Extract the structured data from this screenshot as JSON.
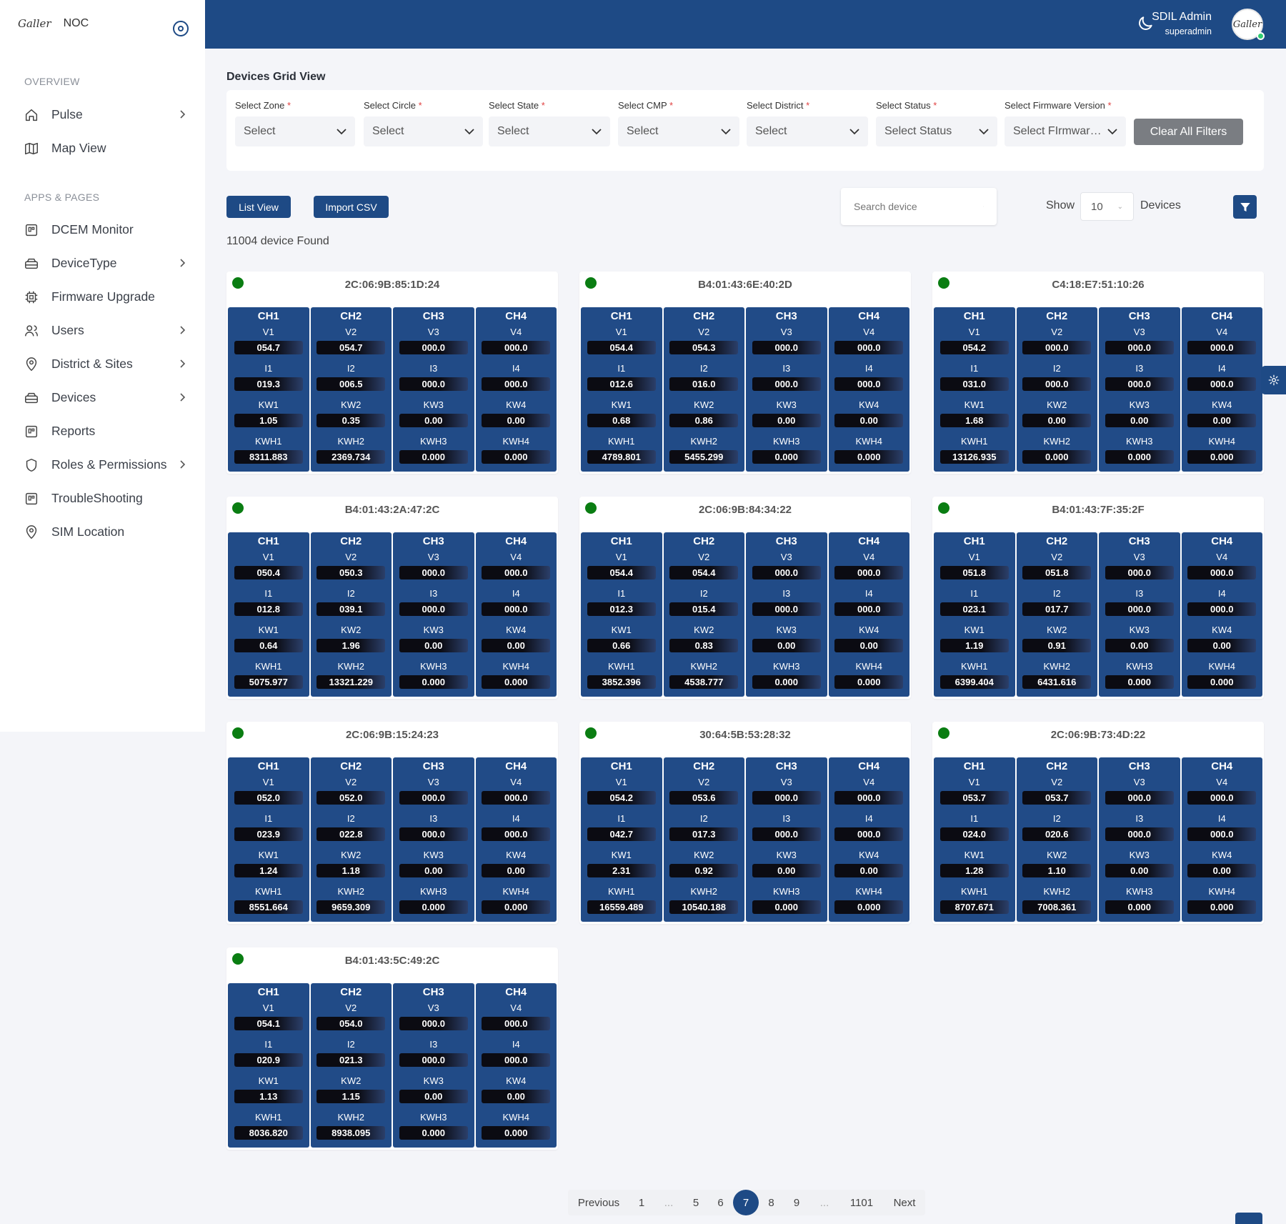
{
  "brand": {
    "logo": "Galler",
    "name": "NOC"
  },
  "sidebar": {
    "overview_title": "OVERVIEW",
    "overview_items": [
      {
        "label": "Pulse",
        "icon": "home-icon",
        "chevron": true
      },
      {
        "label": "Map View",
        "icon": "map-icon",
        "chevron": false
      }
    ],
    "apps_title": "APPS & PAGES",
    "apps_items": [
      {
        "label": "DCEM Monitor",
        "icon": "monitor-icon",
        "chevron": false
      },
      {
        "label": "DeviceType",
        "icon": "device-type-icon",
        "chevron": true
      },
      {
        "label": "Firmware Upgrade",
        "icon": "chip-icon",
        "chevron": false
      },
      {
        "label": "Users",
        "icon": "users-icon",
        "chevron": true
      },
      {
        "label": "District & Sites",
        "icon": "location-icon",
        "chevron": true
      },
      {
        "label": "Devices",
        "icon": "devices-icon",
        "chevron": true
      },
      {
        "label": "Reports",
        "icon": "reports-icon",
        "chevron": false
      },
      {
        "label": "Roles & Permissions",
        "icon": "shield-icon",
        "chevron": true
      },
      {
        "label": "TroubleShooting",
        "icon": "troubleshoot-icon",
        "chevron": false
      },
      {
        "label": "SIM Location",
        "icon": "pin-icon",
        "chevron": false
      }
    ]
  },
  "header": {
    "user_name": "SDIL Admin",
    "user_role": "superadmin",
    "avatar_text": "Galler"
  },
  "main": {
    "title": "Devices Grid View",
    "filters": [
      {
        "label": "Select Zone",
        "value": "Select"
      },
      {
        "label": "Select Circle",
        "value": "Select"
      },
      {
        "label": "Select State",
        "value": "Select"
      },
      {
        "label": "Select CMP",
        "value": "Select"
      },
      {
        "label": "Select District",
        "value": "Select"
      },
      {
        "label": "Select Status",
        "value": "Select Status"
      },
      {
        "label": "Select Firmware Version",
        "value": "Select FIrmware Version"
      }
    ],
    "required_mark": "*",
    "clear_filters": "Clear All Filters",
    "list_view": "List View",
    "import_csv": "Import CSV",
    "search_placeholder": "Search device",
    "show_label": "Show",
    "show_value": "10",
    "devices_label": "Devices",
    "found_text": "11004 device Found"
  },
  "devices": [
    {
      "mac": "2C:06:9B:85:1D:24",
      "online": true,
      "channels": [
        {
          "v": "054.7",
          "i": "019.3",
          "kw": "1.05",
          "kwh": "8311.883"
        },
        {
          "v": "054.7",
          "i": "006.5",
          "kw": "0.35",
          "kwh": "2369.734"
        },
        {
          "v": "000.0",
          "i": "000.0",
          "kw": "0.00",
          "kwh": "0.000"
        },
        {
          "v": "000.0",
          "i": "000.0",
          "kw": "0.00",
          "kwh": "0.000"
        }
      ]
    },
    {
      "mac": "B4:01:43:6E:40:2D",
      "online": true,
      "channels": [
        {
          "v": "054.4",
          "i": "012.6",
          "kw": "0.68",
          "kwh": "4789.801"
        },
        {
          "v": "054.3",
          "i": "016.0",
          "kw": "0.86",
          "kwh": "5455.299"
        },
        {
          "v": "000.0",
          "i": "000.0",
          "kw": "0.00",
          "kwh": "0.000"
        },
        {
          "v": "000.0",
          "i": "000.0",
          "kw": "0.00",
          "kwh": "0.000"
        }
      ]
    },
    {
      "mac": "C4:18:E7:51:10:26",
      "online": true,
      "channels": [
        {
          "v": "054.2",
          "i": "031.0",
          "kw": "1.68",
          "kwh": "13126.935"
        },
        {
          "v": "000.0",
          "i": "000.0",
          "kw": "0.00",
          "kwh": "0.000"
        },
        {
          "v": "000.0",
          "i": "000.0",
          "kw": "0.00",
          "kwh": "0.000"
        },
        {
          "v": "000.0",
          "i": "000.0",
          "kw": "0.00",
          "kwh": "0.000"
        }
      ]
    },
    {
      "mac": "B4:01:43:2A:47:2C",
      "online": true,
      "channels": [
        {
          "v": "050.4",
          "i": "012.8",
          "kw": "0.64",
          "kwh": "5075.977"
        },
        {
          "v": "050.3",
          "i": "039.1",
          "kw": "1.96",
          "kwh": "13321.229"
        },
        {
          "v": "000.0",
          "i": "000.0",
          "kw": "0.00",
          "kwh": "0.000"
        },
        {
          "v": "000.0",
          "i": "000.0",
          "kw": "0.00",
          "kwh": "0.000"
        }
      ]
    },
    {
      "mac": "2C:06:9B:84:34:22",
      "online": true,
      "channels": [
        {
          "v": "054.4",
          "i": "012.3",
          "kw": "0.66",
          "kwh": "3852.396"
        },
        {
          "v": "054.4",
          "i": "015.4",
          "kw": "0.83",
          "kwh": "4538.777"
        },
        {
          "v": "000.0",
          "i": "000.0",
          "kw": "0.00",
          "kwh": "0.000"
        },
        {
          "v": "000.0",
          "i": "000.0",
          "kw": "0.00",
          "kwh": "0.000"
        }
      ]
    },
    {
      "mac": "B4:01:43:7F:35:2F",
      "online": true,
      "channels": [
        {
          "v": "051.8",
          "i": "023.1",
          "kw": "1.19",
          "kwh": "6399.404"
        },
        {
          "v": "051.8",
          "i": "017.7",
          "kw": "0.91",
          "kwh": "6431.616"
        },
        {
          "v": "000.0",
          "i": "000.0",
          "kw": "0.00",
          "kwh": "0.000"
        },
        {
          "v": "000.0",
          "i": "000.0",
          "kw": "0.00",
          "kwh": "0.000"
        }
      ]
    },
    {
      "mac": "2C:06:9B:15:24:23",
      "online": true,
      "channels": [
        {
          "v": "052.0",
          "i": "023.9",
          "kw": "1.24",
          "kwh": "8551.664"
        },
        {
          "v": "052.0",
          "i": "022.8",
          "kw": "1.18",
          "kwh": "9659.309"
        },
        {
          "v": "000.0",
          "i": "000.0",
          "kw": "0.00",
          "kwh": "0.000"
        },
        {
          "v": "000.0",
          "i": "000.0",
          "kw": "0.00",
          "kwh": "0.000"
        }
      ]
    },
    {
      "mac": "30:64:5B:53:28:32",
      "online": true,
      "channels": [
        {
          "v": "054.2",
          "i": "042.7",
          "kw": "2.31",
          "kwh": "16559.489"
        },
        {
          "v": "053.6",
          "i": "017.3",
          "kw": "0.92",
          "kwh": "10540.188"
        },
        {
          "v": "000.0",
          "i": "000.0",
          "kw": "0.00",
          "kwh": "0.000"
        },
        {
          "v": "000.0",
          "i": "000.0",
          "kw": "0.00",
          "kwh": "0.000"
        }
      ]
    },
    {
      "mac": "2C:06:9B:73:4D:22",
      "online": true,
      "channels": [
        {
          "v": "053.7",
          "i": "024.0",
          "kw": "1.28",
          "kwh": "8707.671"
        },
        {
          "v": "053.7",
          "i": "020.6",
          "kw": "1.10",
          "kwh": "7008.361"
        },
        {
          "v": "000.0",
          "i": "000.0",
          "kw": "0.00",
          "kwh": "0.000"
        },
        {
          "v": "000.0",
          "i": "000.0",
          "kw": "0.00",
          "kwh": "0.000"
        }
      ]
    },
    {
      "mac": "B4:01:43:5C:49:2C",
      "online": true,
      "channels": [
        {
          "v": "054.1",
          "i": "020.9",
          "kw": "1.13",
          "kwh": "8036.820"
        },
        {
          "v": "054.0",
          "i": "021.3",
          "kw": "1.15",
          "kwh": "8938.095"
        },
        {
          "v": "000.0",
          "i": "000.0",
          "kw": "0.00",
          "kwh": "0.000"
        },
        {
          "v": "000.0",
          "i": "000.0",
          "kw": "0.00",
          "kwh": "0.000"
        }
      ]
    }
  ],
  "pagination": {
    "previous": "Previous",
    "next": "Next",
    "pages": [
      "1",
      "...",
      "5",
      "6",
      "7",
      "8",
      "9",
      "...",
      "1101"
    ],
    "current": "7"
  },
  "colors": {
    "primary": "#1e4a85",
    "online": "#0a7d12",
    "clear_button": "#7a7d82"
  }
}
